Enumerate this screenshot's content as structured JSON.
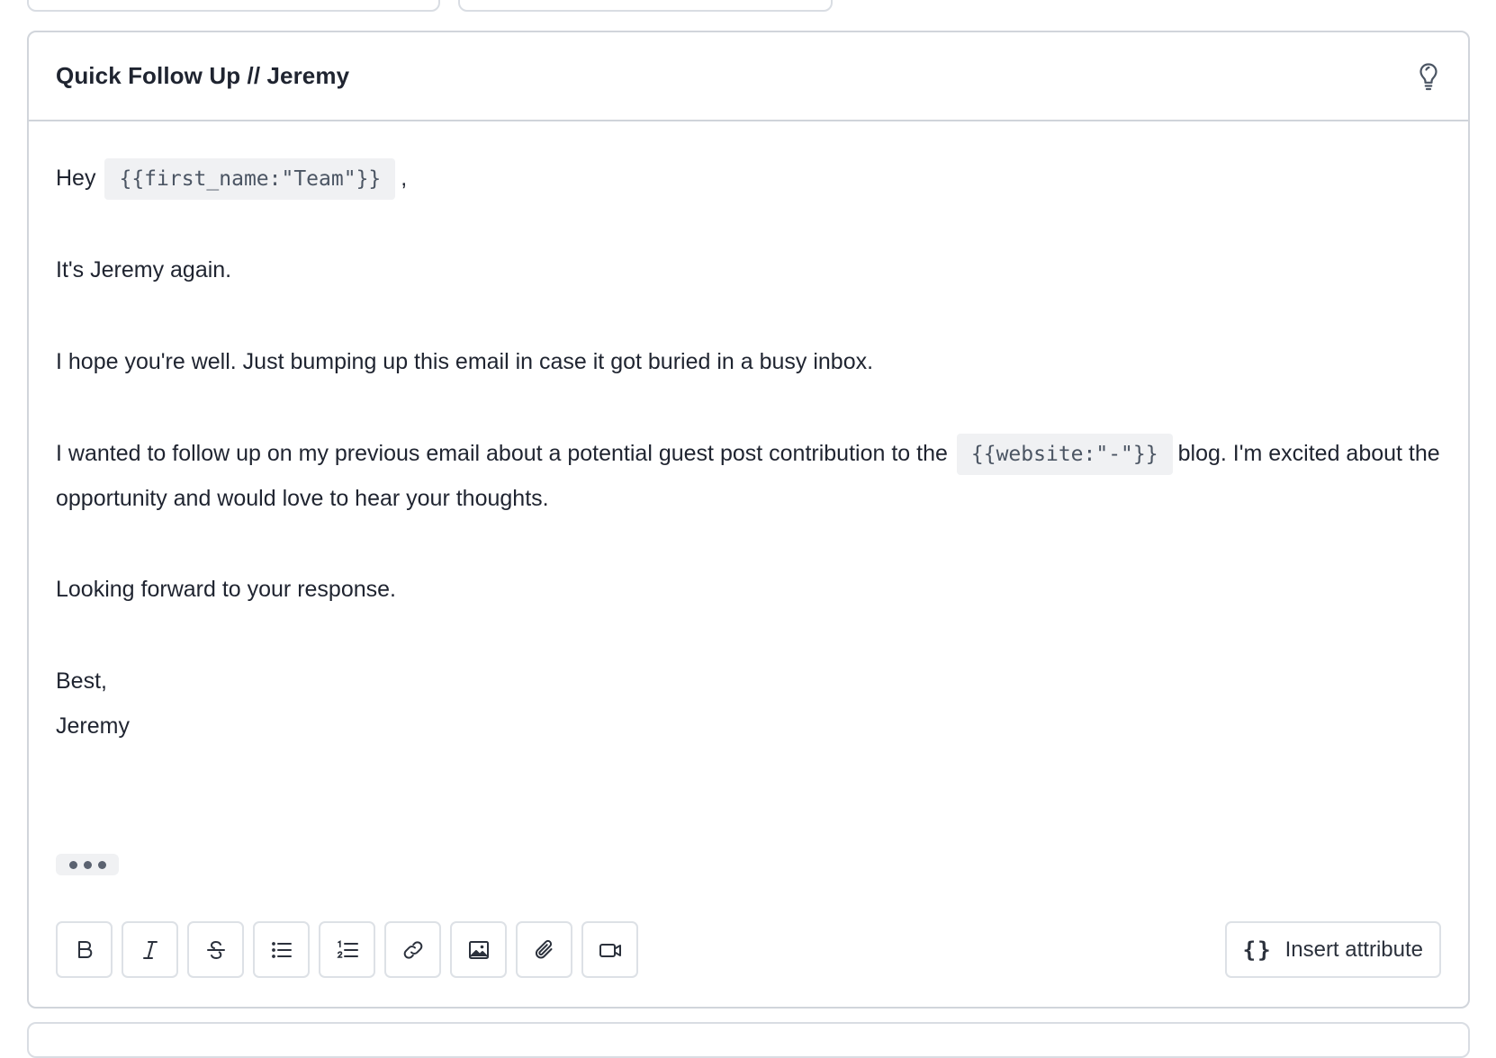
{
  "template": {
    "title": "Quick Follow Up // Jeremy",
    "greeting_prefix": "Hey",
    "greeting_attr": "{{first_name:\"Team\"}}",
    "greeting_suffix": ",",
    "line_intro": "It's Jeremy again.",
    "line_bump": "I hope you're well. Just bumping up this email in case it got buried in a busy inbox.",
    "line_followup_pre": "I wanted to follow up on my previous email about a potential guest post contribution to the",
    "line_followup_attr": "{{website:\"-\"}}",
    "line_followup_post": "blog. I'm excited about the opportunity and would love to hear your thoughts.",
    "line_looking": "Looking forward to your response.",
    "signoff": "Best,",
    "signature": "Jeremy"
  },
  "toolbar": {
    "buttons": [
      {
        "icon": "bold-icon"
      },
      {
        "icon": "italic-icon"
      },
      {
        "icon": "strikethrough-icon"
      },
      {
        "icon": "bullet-list-icon"
      },
      {
        "icon": "numbered-list-icon"
      },
      {
        "icon": "link-icon"
      },
      {
        "icon": "image-icon"
      },
      {
        "icon": "attachment-icon"
      },
      {
        "icon": "video-icon"
      }
    ],
    "insert_attribute_label": "Insert attribute",
    "insert_attribute_icon": "braces-icon"
  },
  "colors": {
    "border": "#d1d5db",
    "attr_bg": "#f0f1f3",
    "text": "#1f2430"
  }
}
